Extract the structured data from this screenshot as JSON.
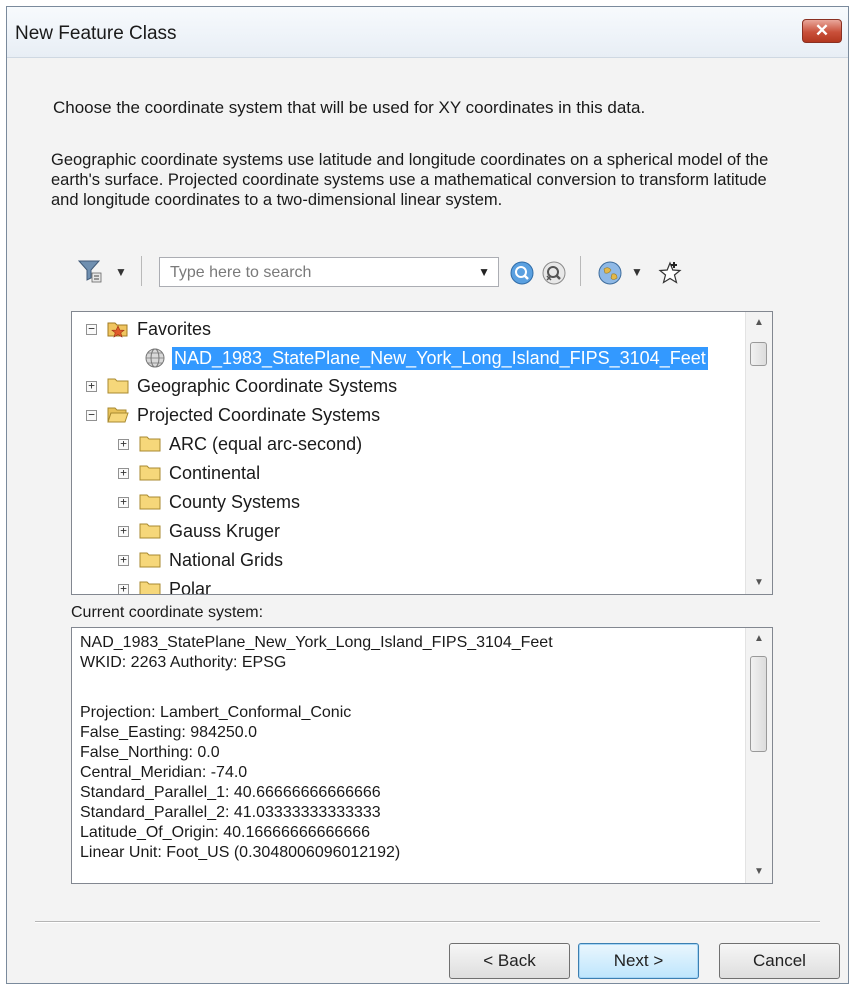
{
  "window": {
    "title": "New Feature Class",
    "close_label": "✕"
  },
  "intro": {
    "line1": "Choose the coordinate system that will be used for XY coordinates in this data.",
    "line2": "Geographic coordinate systems use latitude and longitude coordinates on a spherical model of the earth's surface. Projected coordinate systems use a mathematical conversion to transform latitude and longitude coordinates to a two-dimensional linear system."
  },
  "toolbar": {
    "search_placeholder": "Type here to search",
    "icons": [
      "filter-icon",
      "search-icon",
      "clear-search-icon",
      "globe-icon",
      "add-favorite-icon"
    ]
  },
  "tree": {
    "items": [
      {
        "label": "Favorites",
        "expander": "⊟",
        "icon": "favorites-folder-icon"
      },
      {
        "label": "NAD_1983_StatePlane_New_York_Long_Island_FIPS_3104_Feet",
        "icon": "globe-icon",
        "selected": true
      },
      {
        "label": "Geographic Coordinate Systems",
        "expander": "⊞",
        "icon": "folder-icon"
      },
      {
        "label": "Projected Coordinate Systems",
        "expander": "⊟",
        "icon": "open-folder-icon"
      },
      {
        "label": "ARC (equal arc-second)",
        "expander": "⊞",
        "icon": "folder-icon"
      },
      {
        "label": "Continental",
        "expander": "⊞",
        "icon": "folder-icon"
      },
      {
        "label": "County Systems",
        "expander": "⊞",
        "icon": "folder-icon"
      },
      {
        "label": "Gauss Kruger",
        "expander": "⊞",
        "icon": "folder-icon"
      },
      {
        "label": "National Grids",
        "expander": "⊞",
        "icon": "folder-icon"
      },
      {
        "label": "Polar",
        "expander": "⊞",
        "icon": "folder-icon"
      }
    ]
  },
  "current": {
    "label": "Current coordinate system:",
    "lines": [
      "NAD_1983_StatePlane_New_York_Long_Island_FIPS_3104_Feet",
      "WKID: 2263 Authority: EPSG",
      "",
      "Projection: Lambert_Conformal_Conic",
      "False_Easting: 984250.0",
      "False_Northing: 0.0",
      "Central_Meridian: -74.0",
      "Standard_Parallel_1: 40.66666666666666",
      "Standard_Parallel_2: 41.03333333333333",
      "Latitude_Of_Origin: 40.16666666666666",
      "Linear Unit: Foot_US (0.3048006096012192)"
    ]
  },
  "buttons": {
    "back": "< Back",
    "next": "Next >",
    "cancel": "Cancel"
  }
}
